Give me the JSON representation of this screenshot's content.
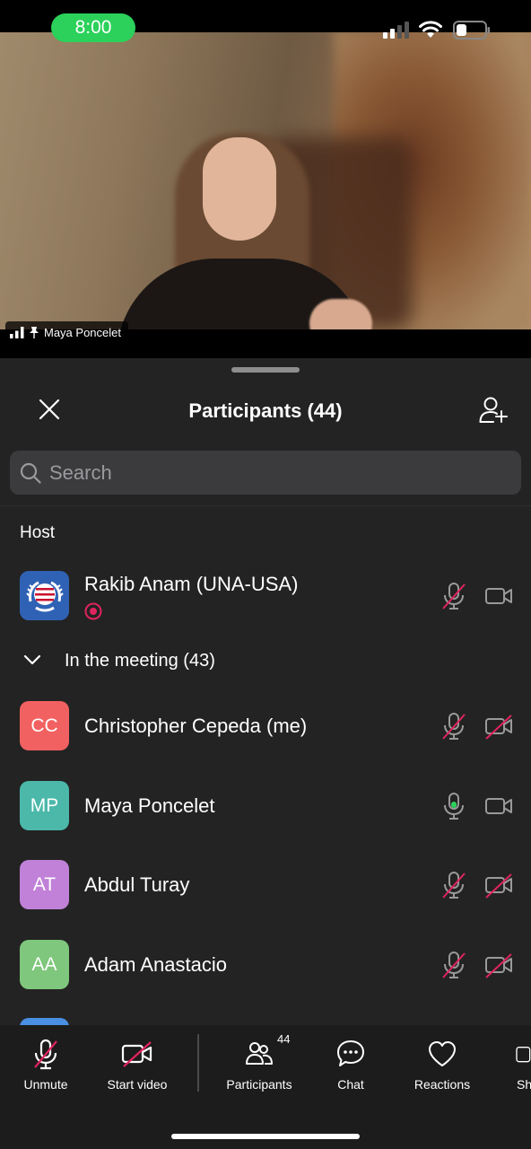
{
  "status_bar": {
    "time": "8:00",
    "clock_color": "#2bd15a"
  },
  "video": {
    "speaker_name": "Maya Poncelet"
  },
  "panel": {
    "title": "Participants (44)",
    "search_placeholder": "Search",
    "host_label": "Host",
    "host": {
      "name": "Rakib Anam (UNA-USA)",
      "mic": "muted",
      "camera": "on",
      "recording": true
    },
    "group_label": "In the meeting (43)",
    "participants": [
      {
        "initials": "CC",
        "name": "Christopher Cepeda (me)",
        "avatar_color": "#f26161",
        "mic": "muted",
        "camera": "off"
      },
      {
        "initials": "MP",
        "name": "Maya Poncelet",
        "avatar_color": "#4bb8aa",
        "mic": "active",
        "camera": "on"
      },
      {
        "initials": "AT",
        "name": "Abdul Turay",
        "avatar_color": "#c181d8",
        "mic": "muted",
        "camera": "off"
      },
      {
        "initials": "AA",
        "name": "Adam Anastacio",
        "avatar_color": "#7ec77c",
        "mic": "muted",
        "camera": "off"
      }
    ]
  },
  "toolbar": {
    "unmute": "Unmute",
    "start_video": "Start video",
    "participants": "Participants",
    "participants_count": "44",
    "chat": "Chat",
    "reactions": "Reactions",
    "share": "Sh"
  },
  "colors": {
    "muted_slash": "#e0245e",
    "active_mic": "#2bd15a",
    "sheet_bg": "#232323"
  }
}
